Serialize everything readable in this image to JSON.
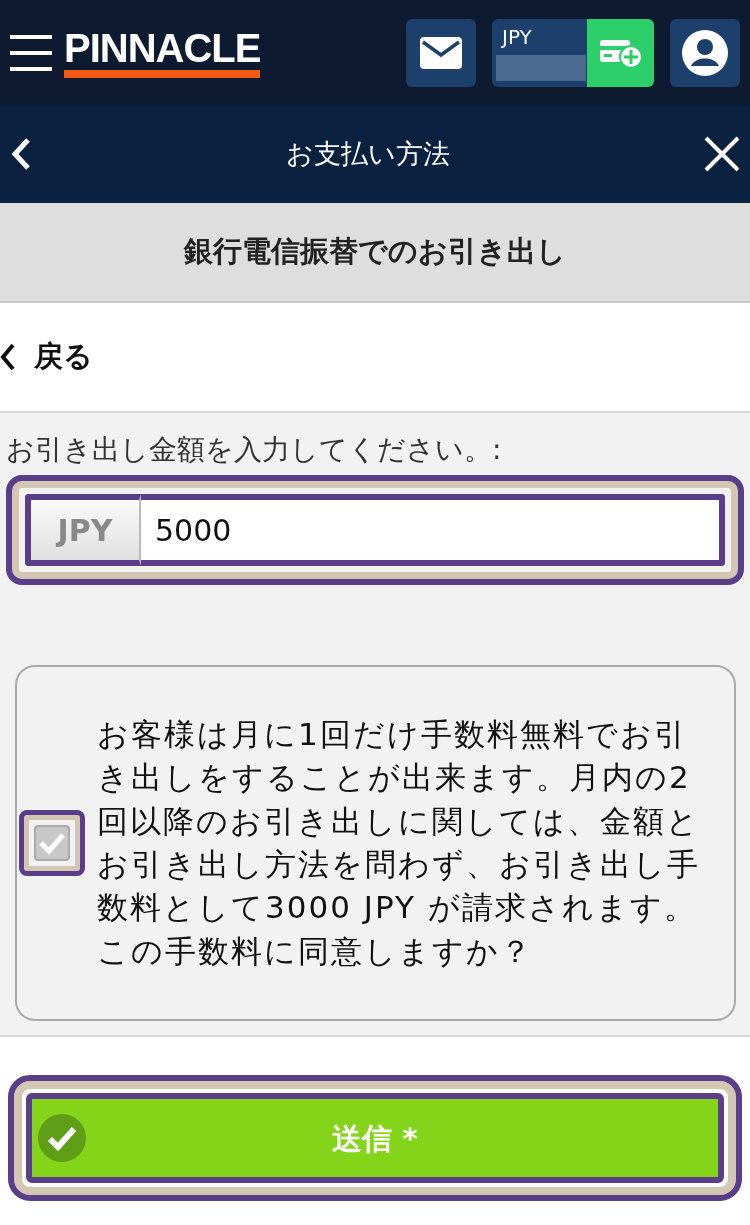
{
  "header": {
    "logo": "PINNACLE",
    "balance": {
      "currency": "JPY"
    }
  },
  "subheader": {
    "title": "お支払い方法"
  },
  "page_title": "銀行電信振替でのお引き出し",
  "back_link": "戻る",
  "amount": {
    "label": "お引き出し金額を入力してください。:",
    "currency": "JPY",
    "value": "5000"
  },
  "fee_notice": {
    "text": "お客様は月に1回だけ手数料無料でお引き出しをすることが出来ます。月内の2回以降のお引き出しに関しては、金額とお引き出し方法を問わず、お引き出し手数料として3000 JPY が請求されます。この手数料に同意しますか？",
    "checked": true
  },
  "submit": {
    "label": "送信",
    "required_mark": "*"
  }
}
